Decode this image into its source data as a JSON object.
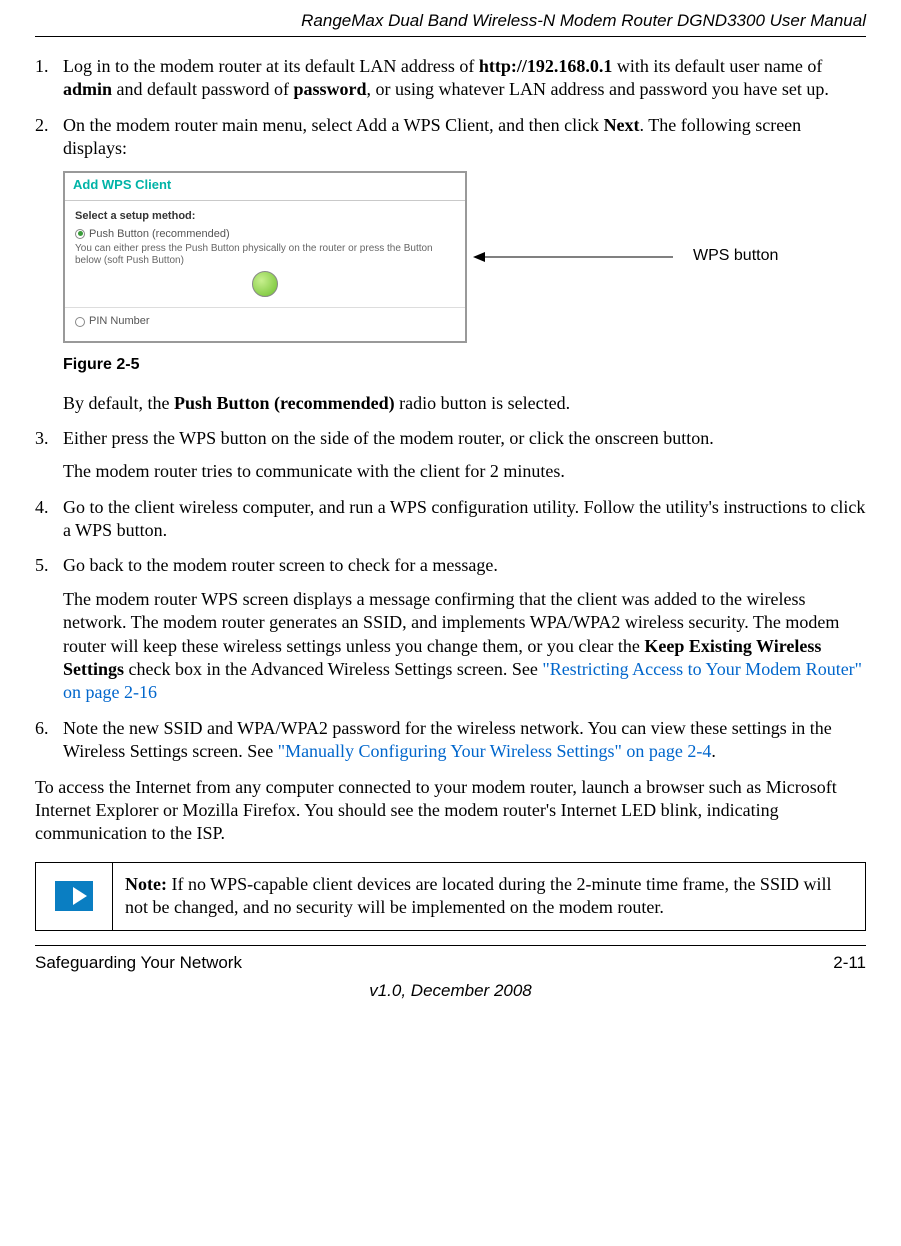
{
  "header": {
    "running_title": "RangeMax Dual Band Wireless-N Modem Router DGND3300 User Manual"
  },
  "steps": {
    "s1": {
      "num": "1.",
      "prefix": "Log in to the modem router at its default LAN address of ",
      "url": "http://192.168.0.1",
      "mid1": " with its default user name of ",
      "admin": "admin",
      "mid2": " and default password of ",
      "password": "password",
      "suffix": ", or using whatever LAN address and password you have set up."
    },
    "s2": {
      "num": "2.",
      "prefix": "On the modem router main menu, select Add a WPS Client, and then click ",
      "next": "Next",
      "suffix": ". The following screen displays:"
    },
    "figure": {
      "panel_title": "Add WPS Client",
      "subhead": "Select a setup method:",
      "radio1": "Push Button (recommended)",
      "desc": "You can either press the Push Button physically on the router or press the Button below (soft Push Button)",
      "radio2": "PIN Number",
      "callout": "WPS button",
      "caption": "Figure 2-5"
    },
    "after_fig": {
      "prefix": "By default, the ",
      "bold": "Push Button (recommended)",
      "suffix": " radio button is selected."
    },
    "s3": {
      "num": "3.",
      "p1": "Either press the WPS button on the side of the modem router, or click the onscreen button.",
      "p2": "The modem router tries to communicate with the client for 2 minutes."
    },
    "s4": {
      "num": "4.",
      "text": "Go to the client wireless computer, and run a WPS configuration utility. Follow the utility's instructions to click a WPS button."
    },
    "s5": {
      "num": "5.",
      "p1": "Go back to the modem router screen to check for a message.",
      "p2_prefix": "The modem router WPS screen displays a message confirming that the client was added to the wireless network. The modem router generates an SSID, and implements WPA/WPA2 wireless security. The modem router will keep these wireless settings unless you change them, or you clear the ",
      "p2_bold": "Keep Existing Wireless Settings",
      "p2_mid": " check box in the Advanced Wireless Settings screen. See ",
      "p2_link": "\"Restricting Access to Your Modem Router\" on page 2-16"
    },
    "s6": {
      "num": "6.",
      "prefix": "Note the new SSID and WPA/WPA2 password for the wireless network. You can view these settings in the Wireless Settings screen. See ",
      "link": "\"Manually Configuring Your Wireless Settings\" on page 2-4",
      "suffix": "."
    }
  },
  "closing": "To access the Internet from any computer connected to your modem router, launch a browser such as Microsoft Internet Explorer or Mozilla Firefox. You should see the modem router's Internet LED blink, indicating communication to the ISP.",
  "note": {
    "label": "Note:",
    "text": " If no WPS-capable client devices are located during the 2-minute time frame, the SSID will not be changed, and no security will be implemented on the modem router."
  },
  "footer": {
    "left": "Safeguarding Your Network",
    "right": "2-11",
    "version": "v1.0, December 2008"
  }
}
